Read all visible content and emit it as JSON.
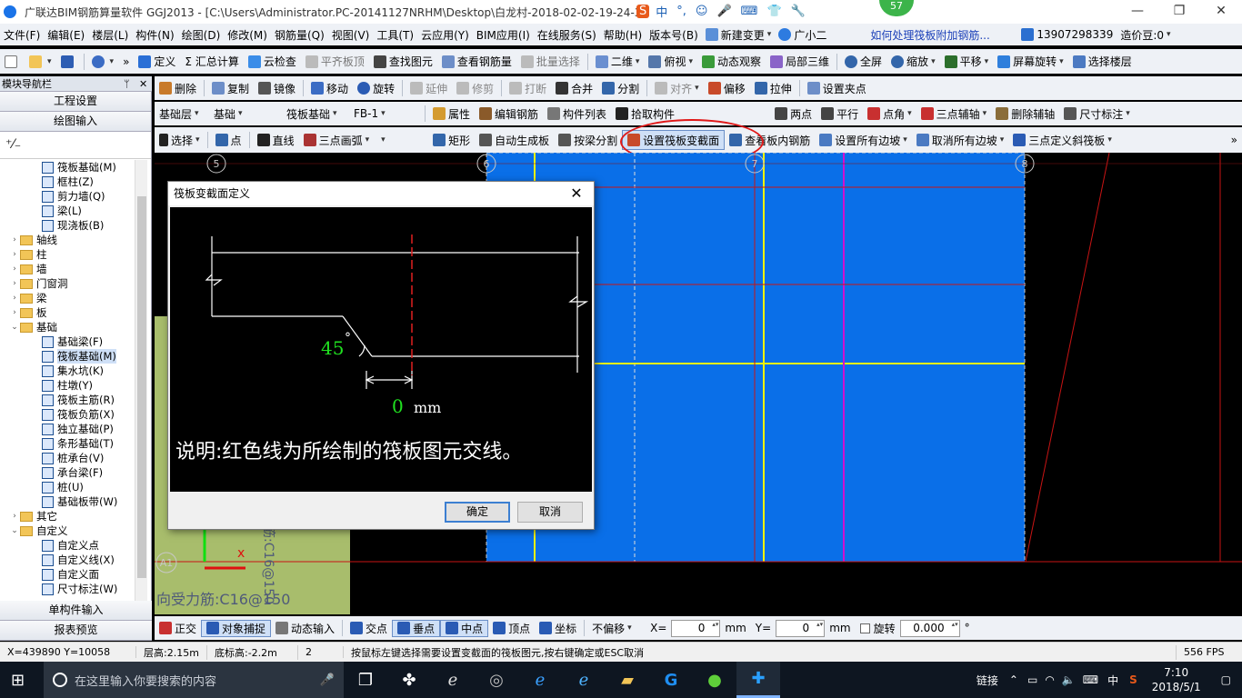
{
  "titlebar": {
    "title": "广联达BIM钢筋算量软件 GGJ2013 - [C:\\Users\\Administrator.PC-20141127NRHM\\Desktop\\白龙村-2018-02-02-19-24-35",
    "ime_label": "中",
    "badge_count": "57",
    "minimize": "—",
    "restore": "❐",
    "close": "✕"
  },
  "menubar": {
    "items": [
      "文件(F)",
      "编辑(E)",
      "楼层(L)",
      "构件(N)",
      "绘图(D)",
      "修改(M)",
      "钢筋量(Q)",
      "视图(V)",
      "工具(T)",
      "云应用(Y)",
      "BIM应用(I)",
      "在线服务(S)",
      "帮助(H)",
      "版本号(B)"
    ],
    "new_change": "新建变更",
    "assistant": "广小二",
    "help_link": "如何处理筏板附加钢筋...",
    "phone": "13907298339",
    "beans": "造价豆:0"
  },
  "toolbar1": {
    "items": [
      "定义",
      "Σ 汇总计算",
      "云检查",
      "平齐板顶",
      "查找图元",
      "查看钢筋量",
      "批量选择",
      "二维",
      "俯视",
      "动态观察",
      "局部三维",
      "全屏",
      "缩放",
      "平移",
      "屏幕旋转",
      "选择楼层"
    ]
  },
  "nav": {
    "header": "模块导航栏",
    "pin": "ᛘ",
    "close": "✕",
    "project_settings": "工程设置",
    "drawing_input": "绘图输入",
    "tools_icons": "⁺⁄₋",
    "tree": [
      {
        "label": "筏板基础(M)",
        "level": 2,
        "type": "leaf"
      },
      {
        "label": "框柱(Z)",
        "level": 2,
        "type": "leaf"
      },
      {
        "label": "剪力墙(Q)",
        "level": 2,
        "type": "leaf"
      },
      {
        "label": "梁(L)",
        "level": 2,
        "type": "leaf"
      },
      {
        "label": "现浇板(B)",
        "level": 2,
        "type": "leaf"
      },
      {
        "label": "轴线",
        "level": 1,
        "type": "folder",
        "exp": "›"
      },
      {
        "label": "柱",
        "level": 1,
        "type": "folder",
        "exp": "›"
      },
      {
        "label": "墙",
        "level": 1,
        "type": "folder",
        "exp": "›"
      },
      {
        "label": "门窗洞",
        "level": 1,
        "type": "folder",
        "exp": "›"
      },
      {
        "label": "梁",
        "level": 1,
        "type": "folder",
        "exp": "›"
      },
      {
        "label": "板",
        "level": 1,
        "type": "folder",
        "exp": "›"
      },
      {
        "label": "基础",
        "level": 1,
        "type": "folder",
        "exp": "⌄"
      },
      {
        "label": "基础梁(F)",
        "level": 2,
        "type": "leaf"
      },
      {
        "label": "筏板基础(M)",
        "level": 2,
        "type": "leaf",
        "selected": true
      },
      {
        "label": "集水坑(K)",
        "level": 2,
        "type": "leaf"
      },
      {
        "label": "柱墩(Y)",
        "level": 2,
        "type": "leaf"
      },
      {
        "label": "筏板主筋(R)",
        "level": 2,
        "type": "leaf"
      },
      {
        "label": "筏板负筋(X)",
        "level": 2,
        "type": "leaf"
      },
      {
        "label": "独立基础(P)",
        "level": 2,
        "type": "leaf"
      },
      {
        "label": "条形基础(T)",
        "level": 2,
        "type": "leaf"
      },
      {
        "label": "桩承台(V)",
        "level": 2,
        "type": "leaf"
      },
      {
        "label": "承台梁(F)",
        "level": 2,
        "type": "leaf"
      },
      {
        "label": "桩(U)",
        "level": 2,
        "type": "leaf"
      },
      {
        "label": "基础板带(W)",
        "level": 2,
        "type": "leaf"
      },
      {
        "label": "其它",
        "level": 1,
        "type": "folder",
        "exp": "›"
      },
      {
        "label": "自定义",
        "level": 1,
        "type": "folder",
        "exp": "⌄"
      },
      {
        "label": "自定义点",
        "level": 2,
        "type": "leaf"
      },
      {
        "label": "自定义线(X)",
        "level": 2,
        "type": "leaf"
      },
      {
        "label": "自定义面",
        "level": 2,
        "type": "leaf"
      },
      {
        "label": "尺寸标注(W)",
        "level": 2,
        "type": "leaf"
      }
    ],
    "single_input": "单构件输入",
    "report_preview": "报表预览"
  },
  "toolbar2": {
    "items": [
      "删除",
      "复制",
      "镜像",
      "移动",
      "旋转",
      "延伸",
      "修剪",
      "打断",
      "合并",
      "分割",
      "对齐",
      "偏移",
      "拉伸",
      "设置夹点"
    ]
  },
  "toolbar3": {
    "floor": "基础层",
    "category": "基础",
    "type": "筏板基础",
    "component": "FB-1",
    "items": [
      "属性",
      "编辑钢筋",
      "构件列表",
      "拾取构件",
      "两点",
      "平行",
      "点角",
      "三点辅轴",
      "删除辅轴",
      "尺寸标注"
    ]
  },
  "toolbar4": {
    "items": [
      "选择",
      "点",
      "直线",
      "三点画弧",
      "矩形",
      "自动生成板",
      "按梁分割",
      "设置筏板变截面",
      "查看板内钢筋",
      "设置所有边坡",
      "取消所有边坡",
      "三点定义斜筏板"
    ],
    "more": "»"
  },
  "canvas": {
    "axis_labels": [
      "5",
      "6",
      "7",
      "8",
      "A1"
    ],
    "rebar_label": "向受力筋:C16@150",
    "rebar_label_vertical": "筋:C16@150"
  },
  "dialog": {
    "title": "筏板变截面定义",
    "angle": "45",
    "degree": "°",
    "offset_value": "0",
    "unit": "mm",
    "note": "说明:红色线为所绘制的筏板图元交线。",
    "ok": "确定",
    "cancel": "取消"
  },
  "dimrow": {
    "items": [
      "正交",
      "对象捕捉",
      "动态输入",
      "交点",
      "垂点",
      "中点",
      "顶点",
      "坐标",
      "不偏移"
    ],
    "x_label": "X=",
    "x_value": "0",
    "y_label": "Y=",
    "y_value": "0",
    "unit": "mm",
    "rotate": "旋转",
    "rotate_value": "0.000",
    "deg": "°"
  },
  "status": {
    "coords": "X=439890  Y=10058",
    "floor_height": "层高:2.15m",
    "bottom_elev": "底标高:-2.2m",
    "count": "2",
    "hint": "按鼠标左键选择需要设置变截面的筏板图元,按右键确定或ESC取消",
    "fps": "556 FPS"
  },
  "taskbar": {
    "search_placeholder": "在这里输入你要搜索的内容",
    "tray_link": "链接",
    "ime": "中",
    "time": "7:10",
    "date": "2018/5/1"
  },
  "colors": {
    "slab_blue": "#0a6fe8",
    "grid_yellow": "#f2f200",
    "grid_magenta": "#d010d0",
    "axis_red": "#c81414",
    "highlight_ellipse": "#e01818"
  }
}
